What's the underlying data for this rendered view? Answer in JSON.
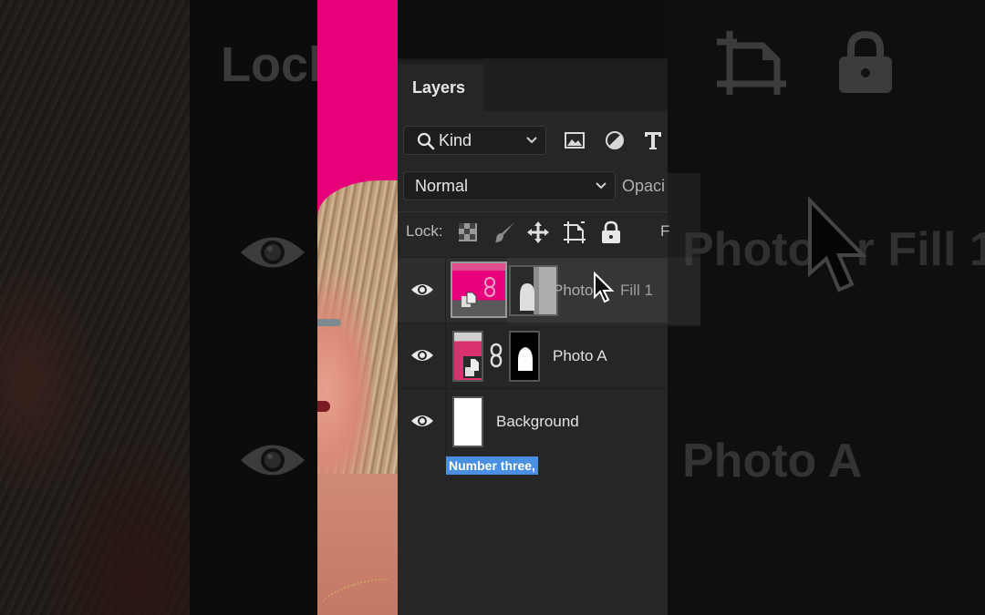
{
  "app": "Adobe Photoshop",
  "panel": {
    "tab_label": "Layers",
    "filter": {
      "kind_label": "Kind",
      "icons": [
        "image-filter-icon",
        "adjustment-filter-icon",
        "type-filter-icon"
      ]
    },
    "blend_mode": "Normal",
    "opacity_label": "Opaci",
    "lock": {
      "label": "Lock:",
      "icons": [
        "lock-transparent-pixels-icon",
        "lock-image-pixels-icon",
        "lock-position-icon",
        "lock-artboard-icon",
        "lock-all-icon"
      ],
      "fill_label": "F"
    },
    "layers": [
      {
        "name": "Photo A copy / Fill 1",
        "display_name": "Photo",
        "overlay_name": "Fill 1",
        "visible": true,
        "selected": true,
        "type": "smart-object-with-mask"
      },
      {
        "name": "Photo A",
        "display_name": "Photo A",
        "visible": true,
        "selected": false,
        "type": "smart-object-with-mask"
      },
      {
        "name": "Background",
        "display_name": "Background",
        "visible": true,
        "selected": false,
        "type": "background"
      }
    ]
  },
  "caption": "Number three,",
  "ghost_zoom": {
    "lock_text": "Lock",
    "layer_text_1": "Photo    r Fill 1",
    "layer_text_2": "Photo A"
  },
  "colors": {
    "canvas_magenta": "#e6007a",
    "panel_bg": "#262626",
    "caption_bg": "#4a90e2"
  }
}
